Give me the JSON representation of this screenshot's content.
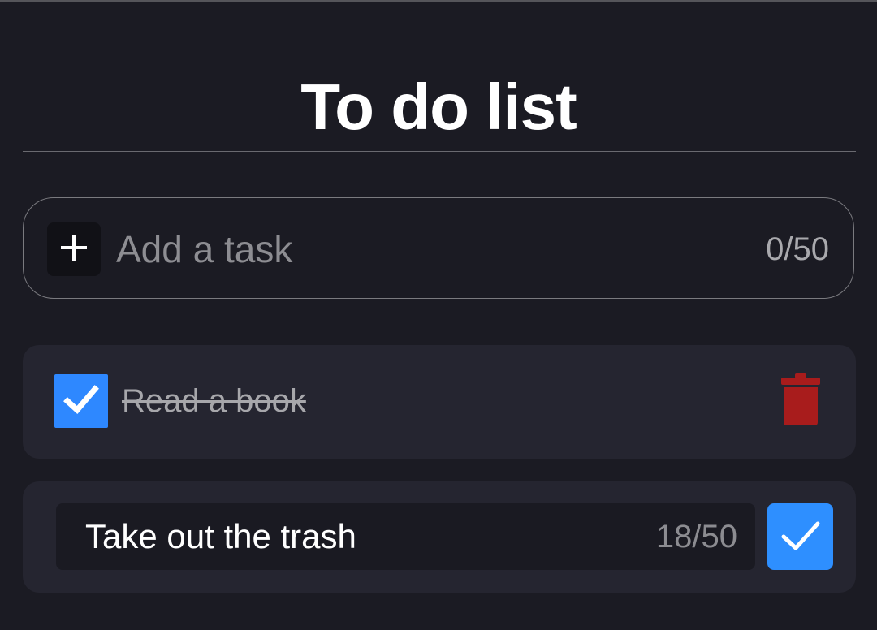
{
  "page": {
    "title": "To do list"
  },
  "add_task": {
    "placeholder": "Add a task",
    "value": "",
    "counter": "0/50",
    "button_icon": "plus-icon"
  },
  "tasks": [
    {
      "text": "Read a book",
      "completed": true,
      "checkbox_icon": "checkmark-icon",
      "delete_icon": "trash-icon"
    },
    {
      "text": "Take out the trash",
      "editing": true,
      "counter": "18/50",
      "save_icon": "checkmark-icon"
    }
  ],
  "colors": {
    "background": "#1b1b23",
    "card": "#252530",
    "accent": "#2e88ff",
    "delete": "#a81c1c",
    "text": "#ffffff",
    "muted_text": "#a7a7ab"
  }
}
